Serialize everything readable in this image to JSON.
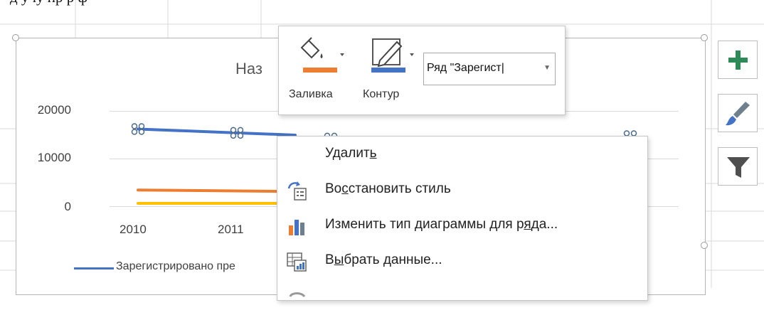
{
  "background_text": "д учу  пр   р ф",
  "chart": {
    "title": "Наз",
    "y_ticks": [
      "20000",
      "10000",
      "0"
    ],
    "x_ticks": [
      "2010",
      "2011"
    ],
    "legend": {
      "label": "Зарегистрировано пре",
      "color": "#4472c4"
    }
  },
  "chart_data": {
    "type": "line",
    "categories": [
      "2010",
      "2011"
    ],
    "ylim": [
      0,
      20000
    ],
    "series": [
      {
        "name": "Зарегистрировано пре",
        "color": "#4472c4",
        "values": [
          16200,
          15400
        ]
      },
      {
        "color": "#ed7d31",
        "values": [
          3400,
          3200
        ]
      },
      {
        "color": "#ffc000",
        "values": [
          600,
          600
        ]
      }
    ]
  },
  "mini_toolbar": {
    "fill_label": "Заливка",
    "outline_label": "Контур",
    "fill_color": "#ed7d31",
    "outline_color": "#4472c4",
    "series_select_value": "Ряд \"Зарегист|"
  },
  "side_buttons": {
    "add_icon": "plus-icon",
    "style_icon": "brush-icon",
    "filter_icon": "filter-icon",
    "add_color": "#2e8b57"
  },
  "context_menu": {
    "items": [
      {
        "pre": "Удалит",
        "key": "ь",
        "post": "",
        "icon": "none"
      },
      {
        "pre": "Во",
        "key": "с",
        "post": "становить стиль",
        "icon": "reset-style-icon"
      },
      {
        "pre": "Изменить тип диаграммы для р",
        "key": "я",
        "post": "да...",
        "icon": "chart-type-icon"
      },
      {
        "pre": "В",
        "key": "ы",
        "post": "брать данные...",
        "icon": "select-data-icon"
      }
    ]
  }
}
